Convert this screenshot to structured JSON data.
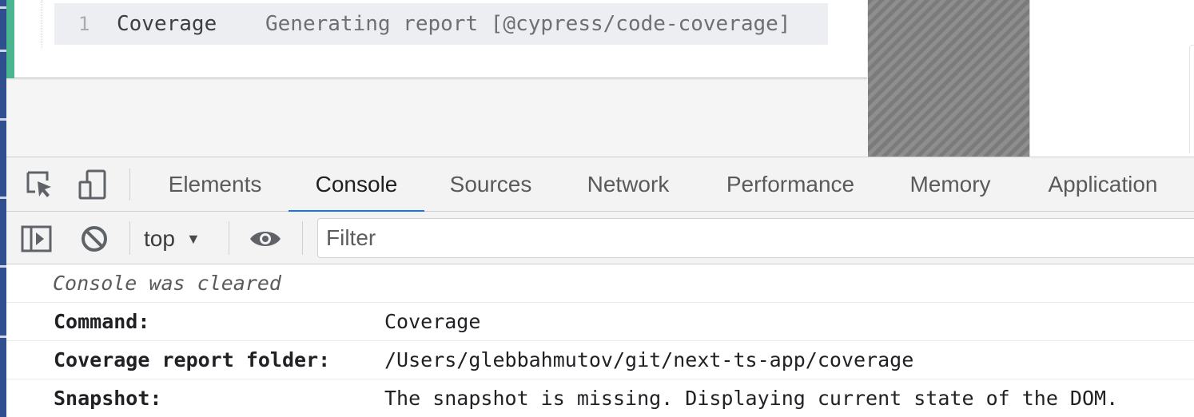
{
  "command_log": {
    "line_number": "1",
    "command": "Coverage",
    "message": "Generating report [@cypress/code-coverage]"
  },
  "devtools": {
    "icons": {
      "inspect": "inspect-element-icon",
      "device": "device-toolbar-icon",
      "sidebar": "show-console-sidebar-icon",
      "clear": "clear-console-icon",
      "eye": "live-expression-eye-icon"
    },
    "tabs": [
      {
        "label": "Elements",
        "active": false
      },
      {
        "label": "Console",
        "active": true
      },
      {
        "label": "Sources",
        "active": false
      },
      {
        "label": "Network",
        "active": false
      },
      {
        "label": "Performance",
        "active": false
      },
      {
        "label": "Memory",
        "active": false
      },
      {
        "label": "Application",
        "active": false
      }
    ],
    "toolbar": {
      "context": "top",
      "filter_placeholder": "Filter"
    },
    "console": {
      "cleared": "Console was cleared",
      "entries": [
        {
          "key": "Command:",
          "value": "Coverage"
        },
        {
          "key": "Coverage report folder:",
          "value": "/Users/glebbahmutov/git/next-ts-app/coverage"
        },
        {
          "key": "Snapshot:",
          "value": "The snapshot is missing. Displaying current state of the DOM."
        }
      ]
    }
  },
  "colors": {
    "accent_green": "#4ab58e",
    "active_tab_underline": "#1a73e8",
    "sidebar_blue": "#2f4f8f"
  }
}
